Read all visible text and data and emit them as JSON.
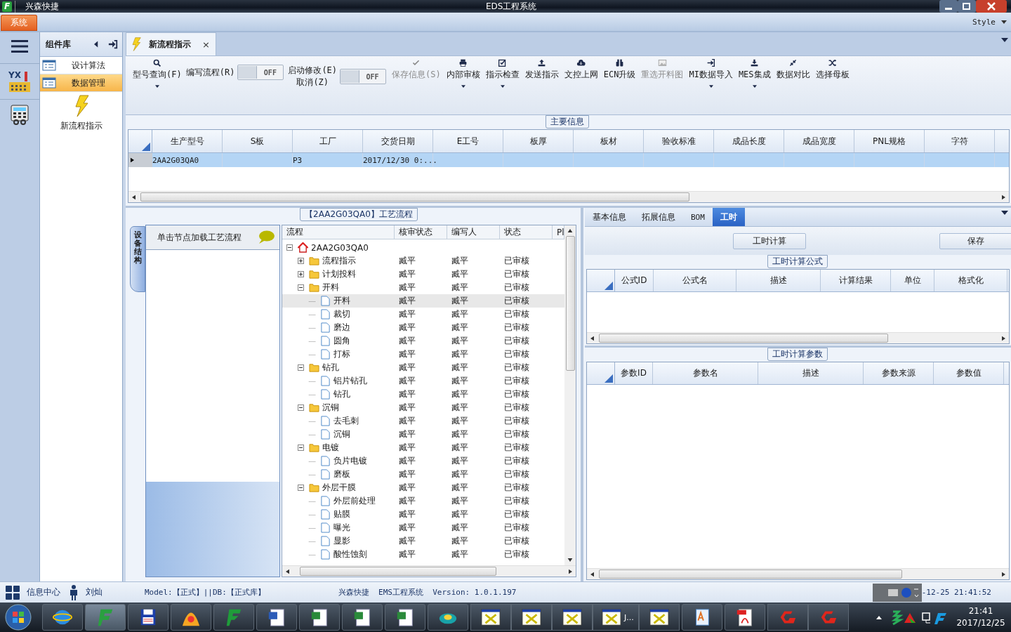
{
  "window": {
    "app_logo": "F",
    "app_name": "兴森快捷",
    "title": "EDS工程系统"
  },
  "ribbon": {
    "tabs": [
      {
        "label": "系统",
        "selected": true
      }
    ],
    "style_menu": "Style"
  },
  "nav": {
    "logo_text": "YX"
  },
  "component_library": {
    "title": "组件库",
    "items": [
      {
        "label": "设计算法",
        "selected": false
      },
      {
        "label": "数据管理",
        "selected": true
      }
    ],
    "launchers": [
      {
        "label": "新流程指示"
      }
    ]
  },
  "document_tabs": [
    {
      "label": "新流程指示",
      "selected": true,
      "close": "×"
    }
  ],
  "toolbar": [
    {
      "kind": "button",
      "label": "型号查询(F)",
      "dropdown": true,
      "disabled": false
    },
    {
      "kind": "toggle",
      "label": "编写流程(R)",
      "switch_text": "OFF",
      "on": false
    },
    {
      "kind": "toggle",
      "label": "启动修改(E)",
      "label_2": "取消(Z)",
      "switch_text": "OFF",
      "on": false
    },
    {
      "kind": "button",
      "label": "保存信息(S)",
      "dropdown": false,
      "disabled": true
    },
    {
      "kind": "button",
      "label": "内部审核",
      "dropdown": true,
      "disabled": false
    },
    {
      "kind": "button",
      "label": "指示检查",
      "dropdown": true,
      "disabled": false
    },
    {
      "kind": "button",
      "label": "发送指示",
      "dropdown": false,
      "disabled": false
    },
    {
      "kind": "button",
      "label": "文控上网",
      "dropdown": false,
      "disabled": false
    },
    {
      "kind": "button",
      "label": "ECN升级",
      "dropdown": false,
      "disabled": false
    },
    {
      "kind": "button",
      "label": "重选开料图",
      "dropdown": false,
      "disabled": true
    },
    {
      "kind": "button",
      "label": "MI数据导入",
      "dropdown": true,
      "disabled": false
    },
    {
      "kind": "button",
      "label": "MES集成",
      "dropdown": true,
      "disabled": false
    },
    {
      "kind": "button",
      "label": "数据对比",
      "dropdown": false,
      "disabled": false
    },
    {
      "kind": "button",
      "label": "选择母板",
      "dropdown": false,
      "disabled": false
    }
  ],
  "main_info": {
    "title": "主要信息",
    "columns": [
      "生产型号",
      "S板",
      "工厂",
      "交货日期",
      "E工号",
      "板厚",
      "板材",
      "验收标准",
      "成品长度",
      "成品宽度",
      "PNL规格",
      "字符"
    ],
    "rows": [
      {
        "selected": true,
        "model": "2AA2G03QA0",
        "factory": "P3",
        "delivery_date": "2017/12/30 0:..."
      }
    ]
  },
  "process_flow": {
    "title": "【2AA2G03QA0】工艺流程",
    "side_tab": "设备结构",
    "hint": "单击节点加载工艺流程",
    "columns": [
      "流程",
      "核审状态",
      "编写人",
      "状态",
      "Pl"
    ],
    "tree": [
      {
        "kind": "root",
        "name": "2AA2G03QA0",
        "expanded": true,
        "selected": false,
        "children": [
          {
            "kind": "folder",
            "name": "流程指示",
            "review_status": "臧平",
            "writer": "臧平",
            "status": "已审核",
            "expanded": false,
            "selected": false
          },
          {
            "kind": "folder",
            "name": "计划投料",
            "review_status": "臧平",
            "writer": "臧平",
            "status": "已审核",
            "expanded": false,
            "selected": false
          },
          {
            "kind": "folder",
            "name": "开料",
            "review_status": "臧平",
            "writer": "臧平",
            "status": "已审核",
            "expanded": true,
            "selected": false,
            "children": [
              {
                "kind": "step",
                "name": "开料",
                "review_status": "臧平",
                "writer": "臧平",
                "status": "已审核",
                "selected": true
              },
              {
                "kind": "step",
                "name": "裁切",
                "review_status": "臧平",
                "writer": "臧平",
                "status": "已审核",
                "selected": false
              },
              {
                "kind": "step",
                "name": "磨边",
                "review_status": "臧平",
                "writer": "臧平",
                "status": "已审核",
                "selected": false
              },
              {
                "kind": "step",
                "name": "圆角",
                "review_status": "臧平",
                "writer": "臧平",
                "status": "已审核",
                "selected": false
              },
              {
                "kind": "step",
                "name": "打标",
                "review_status": "臧平",
                "writer": "臧平",
                "status": "已审核",
                "selected": false
              }
            ]
          },
          {
            "kind": "folder",
            "name": "钻孔",
            "review_status": "臧平",
            "writer": "臧平",
            "status": "已审核",
            "expanded": true,
            "selected": false,
            "children": [
              {
                "kind": "step",
                "name": "铝片钻孔",
                "review_status": "臧平",
                "writer": "臧平",
                "status": "已审核",
                "selected": false
              },
              {
                "kind": "step",
                "name": "钻孔",
                "review_status": "臧平",
                "writer": "臧平",
                "status": "已审核",
                "selected": false
              }
            ]
          },
          {
            "kind": "folder",
            "name": "沉铜",
            "review_status": "臧平",
            "writer": "臧平",
            "status": "已审核",
            "expanded": true,
            "selected": false,
            "children": [
              {
                "kind": "step",
                "name": "去毛刺",
                "review_status": "臧平",
                "writer": "臧平",
                "status": "已审核",
                "selected": false
              },
              {
                "kind": "step",
                "name": "沉铜",
                "review_status": "臧平",
                "writer": "臧平",
                "status": "已审核",
                "selected": false
              }
            ]
          },
          {
            "kind": "folder",
            "name": "电镀",
            "review_status": "臧平",
            "writer": "臧平",
            "status": "已审核",
            "expanded": true,
            "selected": false,
            "children": [
              {
                "kind": "step",
                "name": "负片电镀",
                "review_status": "臧平",
                "writer": "臧平",
                "status": "已审核",
                "selected": false
              },
              {
                "kind": "step",
                "name": "磨板",
                "review_status": "臧平",
                "writer": "臧平",
                "status": "已审核",
                "selected": false
              }
            ]
          },
          {
            "kind": "folder",
            "name": "外层干膜",
            "review_status": "臧平",
            "writer": "臧平",
            "status": "已审核",
            "expanded": true,
            "selected": false,
            "children": [
              {
                "kind": "step",
                "name": "外层前处理",
                "review_status": "臧平",
                "writer": "臧平",
                "status": "已审核",
                "selected": false
              },
              {
                "kind": "step",
                "name": "贴膜",
                "review_status": "臧平",
                "writer": "臧平",
                "status": "已审核",
                "selected": false
              },
              {
                "kind": "step",
                "name": "曝光",
                "review_status": "臧平",
                "writer": "臧平",
                "status": "已审核",
                "selected": false
              },
              {
                "kind": "step",
                "name": "显影",
                "review_status": "臧平",
                "writer": "臧平",
                "status": "已审核",
                "selected": false
              },
              {
                "kind": "step",
                "name": "酸性蚀刻",
                "review_status": "臧平",
                "writer": "臧平",
                "status": "已审核",
                "selected": false
              }
            ]
          }
        ]
      }
    ]
  },
  "detail": {
    "tabs": [
      {
        "label": "基本信息",
        "selected": false
      },
      {
        "label": "拓展信息",
        "selected": false
      },
      {
        "label": "BOM",
        "selected": false
      },
      {
        "label": "工时",
        "selected": true
      }
    ],
    "buttons": [
      "工时计算",
      "保存"
    ],
    "formula_group": {
      "title": "工时计算公式",
      "columns": [
        "公式ID",
        "公式名",
        "描述",
        "计算结果",
        "单位",
        "格式化"
      ]
    },
    "param_group": {
      "title": "工时计算参数",
      "columns": [
        "参数ID",
        "参数名",
        "描述",
        "参数来源",
        "参数值"
      ]
    }
  },
  "status_bar": {
    "info_center": "信息中心",
    "user": "刘灿",
    "environment": "Model:【正式】||DB:【正式库】",
    "version": "兴森快捷  EMS工程系统  Version: 1.0.1.197",
    "datetime": "-12-25 21:41:52"
  },
  "taskbar": {
    "window_label": "J...",
    "clock_time": "21:41",
    "clock_date": "2017/12/25"
  }
}
